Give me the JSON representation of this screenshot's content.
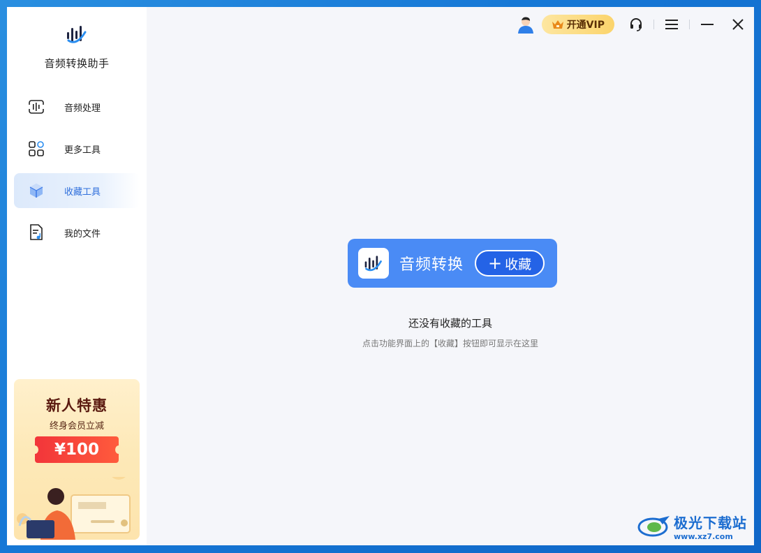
{
  "app": {
    "name": "音频转换助手"
  },
  "sidebar": {
    "items": [
      {
        "label": "音频处理",
        "icon": "audio-process-icon",
        "active": false
      },
      {
        "label": "更多工具",
        "icon": "more-tools-icon",
        "active": false
      },
      {
        "label": "收藏工具",
        "icon": "cube-icon",
        "active": true
      },
      {
        "label": "我的文件",
        "icon": "file-music-icon",
        "active": false
      }
    ],
    "promo": {
      "title": "新人特惠",
      "subtitle": "终身会员立减",
      "coupon": "¥100"
    }
  },
  "titlebar": {
    "vip_label": "开通VIP"
  },
  "main": {
    "card": {
      "title": "音频转换",
      "fav_label": "收藏"
    },
    "empty_title": "还没有收藏的工具",
    "empty_hint": "点击功能界面上的【收藏】按钮即可显示在这里"
  },
  "watermark": {
    "name": "极光下载站",
    "url": "www.xz7.com"
  },
  "colors": {
    "accent": "#2f6fdc",
    "card": "#4a8bf5",
    "vip": "#fbd46c"
  }
}
